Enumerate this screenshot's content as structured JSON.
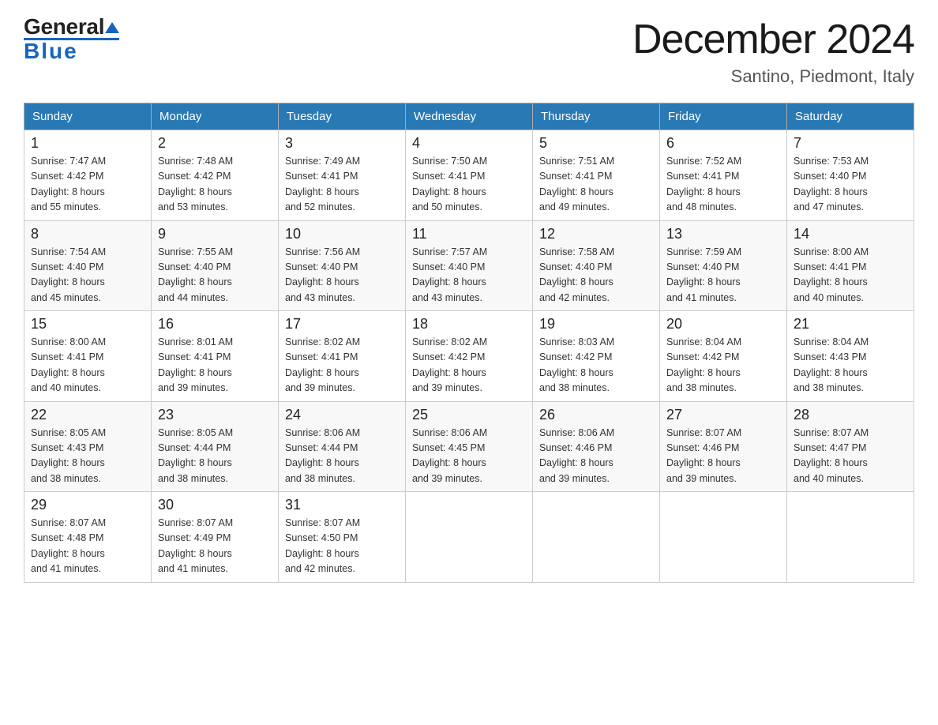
{
  "header": {
    "title": "December 2024",
    "subtitle": "Santino, Piedmont, Italy",
    "logo_general": "General",
    "logo_blue": "Blue"
  },
  "days_of_week": [
    "Sunday",
    "Monday",
    "Tuesday",
    "Wednesday",
    "Thursday",
    "Friday",
    "Saturday"
  ],
  "weeks": [
    [
      {
        "day": "1",
        "sunrise": "7:47 AM",
        "sunset": "4:42 PM",
        "daylight": "8 hours and 55 minutes."
      },
      {
        "day": "2",
        "sunrise": "7:48 AM",
        "sunset": "4:42 PM",
        "daylight": "8 hours and 53 minutes."
      },
      {
        "day": "3",
        "sunrise": "7:49 AM",
        "sunset": "4:41 PM",
        "daylight": "8 hours and 52 minutes."
      },
      {
        "day": "4",
        "sunrise": "7:50 AM",
        "sunset": "4:41 PM",
        "daylight": "8 hours and 50 minutes."
      },
      {
        "day": "5",
        "sunrise": "7:51 AM",
        "sunset": "4:41 PM",
        "daylight": "8 hours and 49 minutes."
      },
      {
        "day": "6",
        "sunrise": "7:52 AM",
        "sunset": "4:41 PM",
        "daylight": "8 hours and 48 minutes."
      },
      {
        "day": "7",
        "sunrise": "7:53 AM",
        "sunset": "4:40 PM",
        "daylight": "8 hours and 47 minutes."
      }
    ],
    [
      {
        "day": "8",
        "sunrise": "7:54 AM",
        "sunset": "4:40 PM",
        "daylight": "8 hours and 45 minutes."
      },
      {
        "day": "9",
        "sunrise": "7:55 AM",
        "sunset": "4:40 PM",
        "daylight": "8 hours and 44 minutes."
      },
      {
        "day": "10",
        "sunrise": "7:56 AM",
        "sunset": "4:40 PM",
        "daylight": "8 hours and 43 minutes."
      },
      {
        "day": "11",
        "sunrise": "7:57 AM",
        "sunset": "4:40 PM",
        "daylight": "8 hours and 43 minutes."
      },
      {
        "day": "12",
        "sunrise": "7:58 AM",
        "sunset": "4:40 PM",
        "daylight": "8 hours and 42 minutes."
      },
      {
        "day": "13",
        "sunrise": "7:59 AM",
        "sunset": "4:40 PM",
        "daylight": "8 hours and 41 minutes."
      },
      {
        "day": "14",
        "sunrise": "8:00 AM",
        "sunset": "4:41 PM",
        "daylight": "8 hours and 40 minutes."
      }
    ],
    [
      {
        "day": "15",
        "sunrise": "8:00 AM",
        "sunset": "4:41 PM",
        "daylight": "8 hours and 40 minutes."
      },
      {
        "day": "16",
        "sunrise": "8:01 AM",
        "sunset": "4:41 PM",
        "daylight": "8 hours and 39 minutes."
      },
      {
        "day": "17",
        "sunrise": "8:02 AM",
        "sunset": "4:41 PM",
        "daylight": "8 hours and 39 minutes."
      },
      {
        "day": "18",
        "sunrise": "8:02 AM",
        "sunset": "4:42 PM",
        "daylight": "8 hours and 39 minutes."
      },
      {
        "day": "19",
        "sunrise": "8:03 AM",
        "sunset": "4:42 PM",
        "daylight": "8 hours and 38 minutes."
      },
      {
        "day": "20",
        "sunrise": "8:04 AM",
        "sunset": "4:42 PM",
        "daylight": "8 hours and 38 minutes."
      },
      {
        "day": "21",
        "sunrise": "8:04 AM",
        "sunset": "4:43 PM",
        "daylight": "8 hours and 38 minutes."
      }
    ],
    [
      {
        "day": "22",
        "sunrise": "8:05 AM",
        "sunset": "4:43 PM",
        "daylight": "8 hours and 38 minutes."
      },
      {
        "day": "23",
        "sunrise": "8:05 AM",
        "sunset": "4:44 PM",
        "daylight": "8 hours and 38 minutes."
      },
      {
        "day": "24",
        "sunrise": "8:06 AM",
        "sunset": "4:44 PM",
        "daylight": "8 hours and 38 minutes."
      },
      {
        "day": "25",
        "sunrise": "8:06 AM",
        "sunset": "4:45 PM",
        "daylight": "8 hours and 39 minutes."
      },
      {
        "day": "26",
        "sunrise": "8:06 AM",
        "sunset": "4:46 PM",
        "daylight": "8 hours and 39 minutes."
      },
      {
        "day": "27",
        "sunrise": "8:07 AM",
        "sunset": "4:46 PM",
        "daylight": "8 hours and 39 minutes."
      },
      {
        "day": "28",
        "sunrise": "8:07 AM",
        "sunset": "4:47 PM",
        "daylight": "8 hours and 40 minutes."
      }
    ],
    [
      {
        "day": "29",
        "sunrise": "8:07 AM",
        "sunset": "4:48 PM",
        "daylight": "8 hours and 41 minutes."
      },
      {
        "day": "30",
        "sunrise": "8:07 AM",
        "sunset": "4:49 PM",
        "daylight": "8 hours and 41 minutes."
      },
      {
        "day": "31",
        "sunrise": "8:07 AM",
        "sunset": "4:50 PM",
        "daylight": "8 hours and 42 minutes."
      },
      null,
      null,
      null,
      null
    ]
  ],
  "labels": {
    "sunrise": "Sunrise:",
    "sunset": "Sunset:",
    "daylight": "Daylight:"
  }
}
